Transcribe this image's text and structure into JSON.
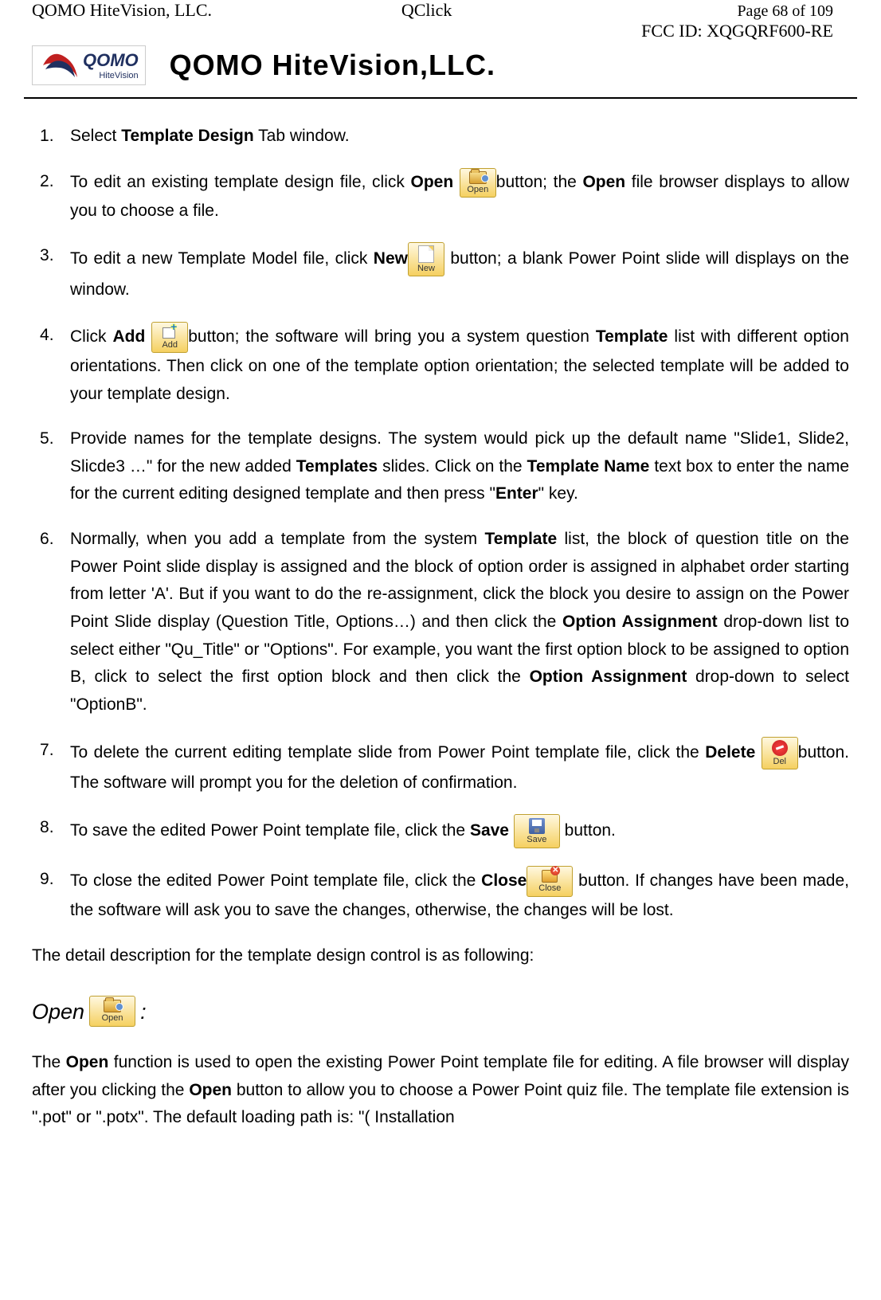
{
  "header": {
    "company_left": "QOMO HiteVision, LLC.",
    "product": "QClick",
    "page_label": "Page 68 of 109",
    "fcc_id": "FCC ID: XQGQRF600-RE",
    "logo_text_main": "QOMO",
    "logo_text_sub": "HiteVision",
    "company_title": "QOMO HiteVision,LLC."
  },
  "buttons": {
    "open": "Open",
    "new": "New",
    "add": "Add",
    "del": "Del",
    "save": "Save",
    "close": "Close"
  },
  "steps": {
    "s1": {
      "p1": "Select ",
      "b1": "Template Design",
      "p2": " Tab window."
    },
    "s2": {
      "p1": "To edit an existing template design file, click ",
      "b1": "Open",
      "p2": "button; the ",
      "b2": "Open",
      "p3": " file browser displays to allow you to choose a file."
    },
    "s3": {
      "p1": "To edit a new Template Model file, click ",
      "b1": "New",
      "p2": " button; a blank Power Point slide will displays on the window."
    },
    "s4": {
      "p1": "Click ",
      "b1": "Add",
      "p2": "button; the software will bring you a system question ",
      "b2": "Template",
      "p3": " list with different option orientations. Then click on one of the template option orientation; the selected template will be added to your template design."
    },
    "s5": {
      "p1": "Provide names for the template designs. The system would pick up the default name \"Slide1, Slide2, Slicde3 …\" for the new added ",
      "b1": "Templates",
      "p2": " slides. Click on the ",
      "b2": "Template Name",
      "p3": " text box to enter the name for the current editing designed template and then press \"",
      "b3": "Enter",
      "p4": "\" key."
    },
    "s6": {
      "p1": "Normally, when you add a template from the system ",
      "b1": "Template",
      "p2": " list, the block of question title on the Power Point slide display is assigned and the block of option order is assigned in alphabet order starting from letter 'A'. But if you want to do the re-assignment, click the block you desire to assign on the Power Point Slide display (Question Title, Options…) and then click the ",
      "b2": "Option Assignment",
      "p3": " drop-down list to select either \"Qu_Title\" or \"Options\". For example, you want the first option block to be assigned to option B, click to select the first option block and then click the ",
      "b3": "Option Assignment",
      "p4": " drop-down to select \"OptionB\"."
    },
    "s7": {
      "p1": "To delete the current editing template slide from Power Point template file, click the ",
      "b1": "Delete",
      "p2": "button. The software will prompt you for the deletion of confirmation."
    },
    "s8": {
      "p1": "To save the edited Power Point template file, click the ",
      "b1": "Save",
      "p2": " button."
    },
    "s9": {
      "p1": "To close the edited Power Point template file, click the ",
      "b1": "Close",
      "p2": " button. If changes have been made, the software will ask you to save the changes, otherwise, the changes will be lost."
    }
  },
  "detail_intro": "The detail description for the template design control is as following:",
  "section_open": {
    "title_prefix": "Open ",
    "title_suffix": ":",
    "paragraph": {
      "p1": "The ",
      "b1": "Open",
      "p2": " function is used to open the existing Power Point template file for editing. A file browser will display after you clicking the ",
      "b2": "Open",
      "p3": " button to allow you to choose a Power Point quiz file. The template file extension is \".pot\" or \".potx\". The default loading path is: \"( Installation"
    }
  }
}
